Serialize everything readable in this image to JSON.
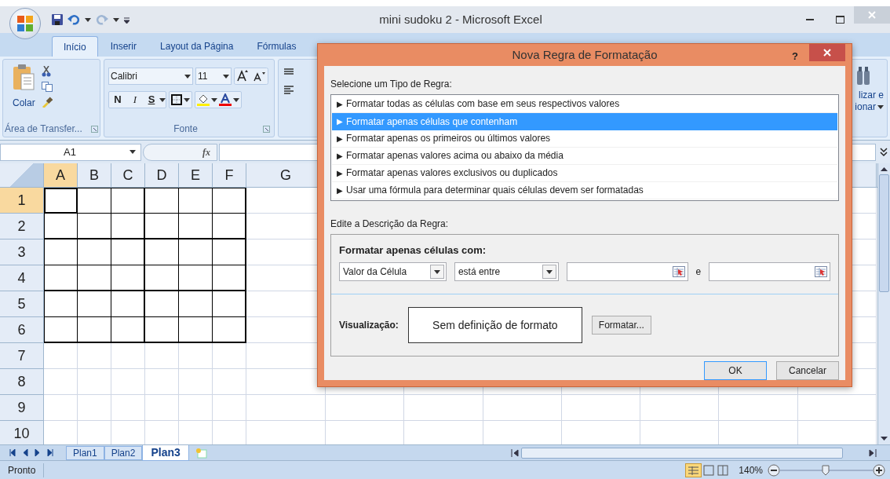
{
  "window": {
    "title": "mini sudoku 2 - Microsoft Excel"
  },
  "ribbon_tabs": [
    {
      "label": "Início",
      "selected": true
    },
    {
      "label": "Inserir",
      "selected": false
    },
    {
      "label": "Layout da Página",
      "selected": false
    },
    {
      "label": "Fórmulas",
      "selected": false
    }
  ],
  "clipboard_group": {
    "paste": "Colar",
    "title": "Área de Transfer..."
  },
  "font_group": {
    "font": "Calibri",
    "size": "11",
    "bold": "N",
    "italic": "I",
    "underline": "S",
    "title": "Fonte"
  },
  "editing_group": {
    "line_1": "lizar e",
    "line_2": "ionar"
  },
  "formula_bar": {
    "name_box": "A1",
    "function_label": "fx"
  },
  "sheet": {
    "columns": [
      "A",
      "B",
      "C",
      "D",
      "E",
      "F",
      "G"
    ],
    "rows": [
      "1",
      "2",
      "3",
      "4",
      "5",
      "6",
      "7",
      "8",
      "9",
      "10"
    ]
  },
  "sheet_tabs": [
    {
      "label": "Plan1",
      "selected": false
    },
    {
      "label": "Plan2",
      "selected": false
    },
    {
      "label": "Plan3",
      "selected": true
    }
  ],
  "status_bar": {
    "status": "Pronto",
    "zoom": "140%"
  },
  "dialog": {
    "title": "Nova Regra de Formatação",
    "help": "?",
    "select_label": "Selecione um Tipo de Regra:",
    "rule_types": [
      {
        "marker": "▶",
        "label": "Formatar todas as células com base em seus respectivos valores",
        "selected": false
      },
      {
        "marker": "▶",
        "label": "Formatar apenas células que contenham",
        "selected": true
      },
      {
        "marker": "▶",
        "label": "Formatar apenas os primeiros ou últimos valores",
        "selected": false
      },
      {
        "marker": "▶",
        "label": "Formatar apenas valores acima ou abaixo da média",
        "selected": false
      },
      {
        "marker": "▶",
        "label": "Formatar apenas valores exclusivos ou duplicados",
        "selected": false
      },
      {
        "marker": "▶",
        "label": "Usar uma fórmula para determinar quais células devem ser formatadas",
        "selected": false
      }
    ],
    "description_label": "Edite a Descrição da Regra:",
    "section_title": "Formatar apenas células com:",
    "condition_field": "Valor da Célula",
    "operator_field": "está entre",
    "joiner": "e",
    "preview_label": "Visualização:",
    "preview_text": "Sem definição de formato",
    "format_button": "Formatar...",
    "buttons": [
      "OK",
      "Cancelar"
    ]
  }
}
